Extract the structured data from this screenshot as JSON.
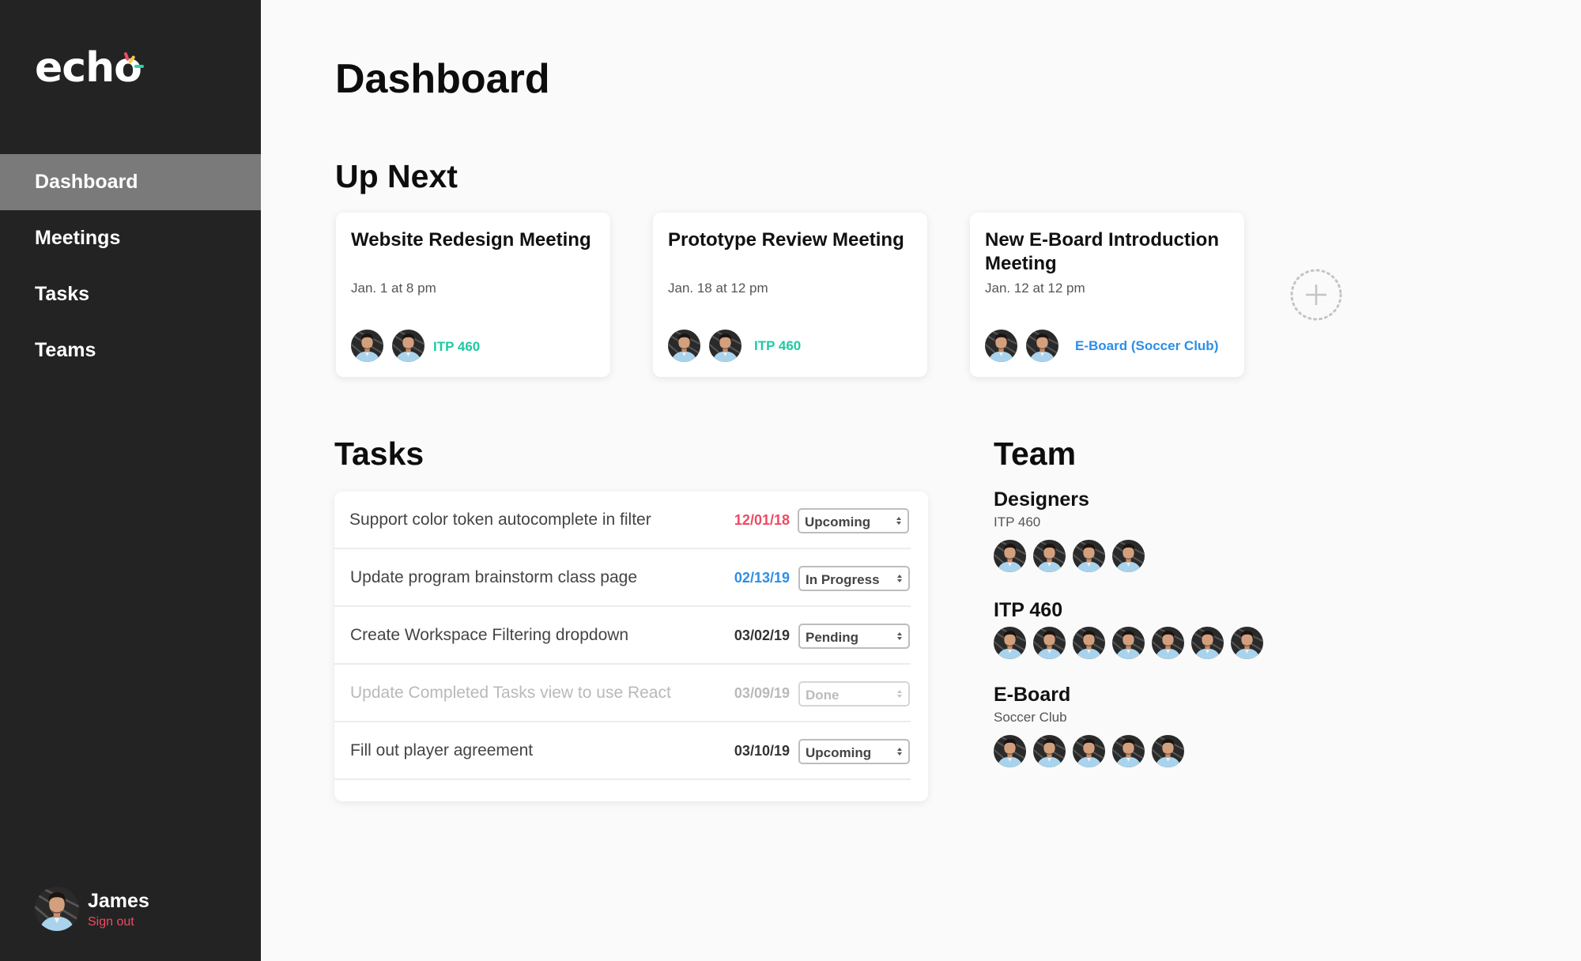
{
  "app": {
    "logo": "echo",
    "accent_colors": [
      "#ef4a63",
      "#f7c948",
      "#2ecfa8"
    ]
  },
  "sidebar": {
    "items": [
      {
        "label": "Dashboard",
        "active": true
      },
      {
        "label": "Meetings",
        "active": false
      },
      {
        "label": "Tasks",
        "active": false
      },
      {
        "label": "Teams",
        "active": false
      }
    ],
    "user": {
      "name": "James",
      "signout": "Sign out"
    }
  },
  "main": {
    "title": "Dashboard",
    "up_next": {
      "title": "Up Next",
      "meetings": [
        {
          "title": "Website Redesign Meeting",
          "date": "Jan. 1 at 8 pm",
          "team": "ITP 460",
          "team_color": "#1fc9a3"
        },
        {
          "title": "Prototype Review Meeting",
          "date": "Jan. 18 at 12 pm",
          "team": "ITP 460",
          "team_color": "#1fc9a3"
        },
        {
          "title": "New E-Board Introduction Meeting",
          "date": "Jan. 12 at 12 pm",
          "team": "E-Board (Soccer Club)",
          "team_color": "#2d8ee8"
        }
      ],
      "add_icon": "plus-icon"
    },
    "tasks": {
      "title": "Tasks",
      "rows": [
        {
          "text": "Support color token autocomplete in filter",
          "date": "12/01/18",
          "date_color": "#ef4a63",
          "status": "Upcoming"
        },
        {
          "text": "Update program brainstorm class page",
          "date": "02/13/19",
          "date_color": "#2d8ee8",
          "status": "In Progress"
        },
        {
          "text": "Create Workspace Filtering dropdown",
          "date": "03/02/19",
          "date_color": "#333333",
          "status": "Pending"
        },
        {
          "text": "Update Completed Tasks view to use React",
          "date": "03/09/19",
          "date_color": "#b9b9b9",
          "status": "Done"
        },
        {
          "text": "Fill out player agreement",
          "date": "03/10/19",
          "date_color": "#333333",
          "status": "Upcoming"
        }
      ]
    },
    "team": {
      "title": "Team",
      "groups": [
        {
          "name": "Designers",
          "subtitle": "ITP 460",
          "members": 4
        },
        {
          "name": "ITP 460",
          "subtitle": "",
          "members": 7
        },
        {
          "name": "E-Board",
          "subtitle": "Soccer Club",
          "members": 5
        }
      ]
    }
  }
}
